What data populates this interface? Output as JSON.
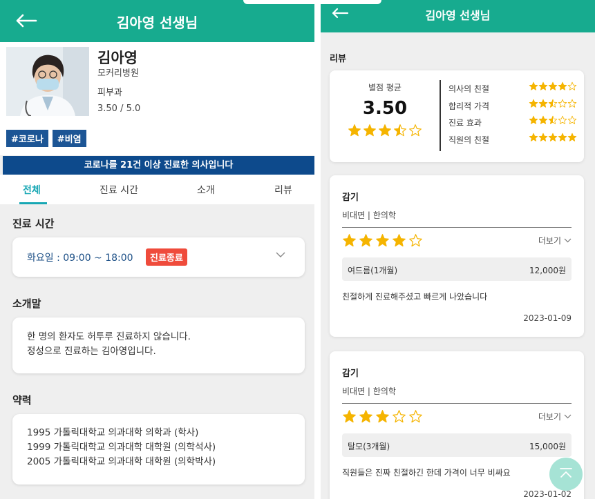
{
  "left": {
    "header": {
      "title": "김아영 선생님",
      "back_icon": "arrow-left-icon"
    },
    "profile": {
      "name": "김아영",
      "hospital": "모커리병원",
      "department": "피부과",
      "rating": "3.50 / 5.0"
    },
    "tags": [
      "#코로나",
      "#비염"
    ],
    "banner": "코로나를 21건 이상 진료한 의사입니다",
    "tabs": [
      {
        "label": "전체",
        "active": true
      },
      {
        "label": "진료 시간",
        "active": false
      },
      {
        "label": "소개",
        "active": false
      },
      {
        "label": "리뷰",
        "active": false
      }
    ],
    "hours": {
      "section_title": "진료 시간",
      "text": "화요일 : 09:00 ~ 18:00",
      "status": "진료종료"
    },
    "intro": {
      "section_title": "소개말",
      "lines": [
        "한 명의 환자도 허투루 진료하지 않습니다.",
        "정성으로 진료하는 김아영입니다."
      ]
    },
    "career": {
      "section_title": "약력",
      "lines": [
        "1995 가톨릭대학교 의과대학 의학과 (학사)",
        "1999 가톨릭대학교 의과대학 대학원 (의학석사)",
        "2005 가톨릭대학교 의과대학 대학원 (의학박사)"
      ]
    }
  },
  "right": {
    "header": {
      "title": "김아영 선생님"
    },
    "section_title": "리뷰",
    "summary": {
      "label": "별점 평균",
      "value": "3.50",
      "stars": 3.5,
      "criteria": [
        {
          "label": "의사의 친절",
          "stars": 4
        },
        {
          "label": "합리적 가격",
          "stars": 2.5
        },
        {
          "label": "진료 효과",
          "stars": 2.5
        },
        {
          "label": "직원의 친절",
          "stars": 5
        }
      ]
    },
    "reviews": [
      {
        "title": "감기",
        "sub": "비대면 | 한의학",
        "stars": 4,
        "more": "더보기",
        "item": "여드름(1개월)",
        "price": "12,000원",
        "comment": "친절하게 진료해주셨고 빠르게 나았습니다",
        "date": "2023-01-09"
      },
      {
        "title": "감기",
        "sub": "비대면 | 한의학",
        "stars": 3,
        "more": "더보기",
        "item": "탈모(3개월)",
        "price": "15,000원",
        "comment": "직원들은 진짜 친절하긴 한데 가격이 너무 비싸요",
        "date": "2023-01-02"
      }
    ]
  },
  "colors": {
    "header": "#17ab8f",
    "tag": "#1c5595",
    "banner": "#0d4a8c",
    "tab_active": "#17a7b4",
    "badge": "#ef4b3b",
    "star": "#f5b400"
  }
}
